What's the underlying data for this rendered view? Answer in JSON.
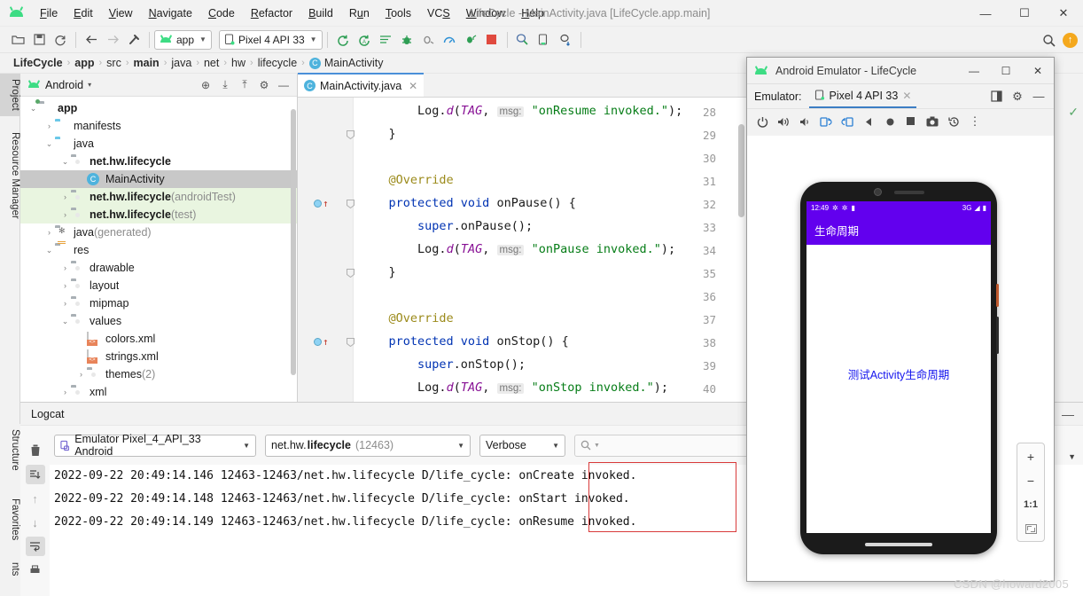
{
  "window": {
    "title": "LifeCycle - MainActivity.java [LifeCycle.app.main]",
    "minimize": "—",
    "maximize": "☐",
    "close": "✕"
  },
  "menu": {
    "items": [
      {
        "label": "File"
      },
      {
        "label": "Edit"
      },
      {
        "label": "View"
      },
      {
        "label": "Navigate"
      },
      {
        "label": "Code"
      },
      {
        "label": "Refactor"
      },
      {
        "label": "Build"
      },
      {
        "label": "Run"
      },
      {
        "label": "Tools"
      },
      {
        "label": "VCS"
      },
      {
        "label": "Window"
      },
      {
        "label": "Help"
      }
    ]
  },
  "toolbar": {
    "open_icon": "🗁",
    "save_icon": "💾",
    "sync_icon": "↻",
    "back_icon": "←",
    "forward_icon": "→",
    "build_icon": "🔨",
    "module_selector": "app",
    "device_selector": "Pixel 4 API 33",
    "run_icon": "▶",
    "run_label": "Run",
    "debug_label": "Debug",
    "search_icon": "🔍",
    "update_badge": "⬆"
  },
  "breadcrumb": {
    "items": [
      "LifeCycle",
      "app",
      "src",
      "main",
      "java",
      "net",
      "hw",
      "lifecycle"
    ],
    "class_badge": "C",
    "class_name": "MainActivity",
    "separator": "›"
  },
  "left_rail": {
    "project_tab": "Project",
    "resource_manager_tab": "Resource Manager"
  },
  "bottom_left_rail": {
    "structure_tab": "Structure",
    "favorites_tab": "Favorites",
    "partial_tab": "nts"
  },
  "project_panel": {
    "header_label": "Android",
    "header_caret": "▾",
    "icons": {
      "locate": "⊕",
      "expand": "⤓",
      "collapse": "⤒",
      "settings": "⚙",
      "hide": "—"
    },
    "tree": [
      {
        "label": "app",
        "indent": 0,
        "arrow": "⌄",
        "icon": "module",
        "bold": true
      },
      {
        "label": "manifests",
        "indent": 1,
        "arrow": "›",
        "icon": "folder-blue"
      },
      {
        "label": "java",
        "indent": 1,
        "arrow": "⌄",
        "icon": "folder-blue"
      },
      {
        "label": "net.hw.lifecycle",
        "indent": 2,
        "arrow": "⌄",
        "icon": "package",
        "bold": true
      },
      {
        "label": "MainActivity",
        "indent": 3,
        "arrow": "",
        "icon": "class",
        "selected": true
      },
      {
        "label": "net.hw.lifecycle",
        "suffix": " (androidTest)",
        "indent": 2,
        "arrow": "›",
        "icon": "package",
        "bold": true,
        "greenbg": true
      },
      {
        "label": "net.hw.lifecycle",
        "suffix": " (test)",
        "indent": 2,
        "arrow": "›",
        "icon": "package",
        "bold": true,
        "greenbg": true
      },
      {
        "label": "java",
        "suffix": " (generated)",
        "indent": 1,
        "arrow": "›",
        "icon": "generated"
      },
      {
        "label": "res",
        "indent": 1,
        "arrow": "⌄",
        "icon": "res"
      },
      {
        "label": "drawable",
        "indent": 2,
        "arrow": "›",
        "icon": "package"
      },
      {
        "label": "layout",
        "indent": 2,
        "arrow": "›",
        "icon": "package"
      },
      {
        "label": "mipmap",
        "indent": 2,
        "arrow": "›",
        "icon": "package"
      },
      {
        "label": "values",
        "indent": 2,
        "arrow": "⌄",
        "icon": "package"
      },
      {
        "label": "colors.xml",
        "indent": 3,
        "arrow": "",
        "icon": "xml"
      },
      {
        "label": "strings.xml",
        "indent": 3,
        "arrow": "",
        "icon": "xml"
      },
      {
        "label": "themes",
        "suffix": " (2)",
        "indent": 3,
        "arrow": "›",
        "icon": "package"
      },
      {
        "label": "xml",
        "indent": 2,
        "arrow": "›",
        "icon": "package"
      }
    ]
  },
  "editor": {
    "tab_badge": "C",
    "tab_label": "MainActivity.java",
    "tab_close": "✕",
    "lines": [
      {
        "num": "28",
        "segments": [
          {
            "t": "        ",
            "c": "plain"
          },
          {
            "t": "Log",
            "c": "plain"
          },
          {
            "t": ".",
            "c": "plain"
          },
          {
            "t": "d",
            "c": "fld"
          },
          {
            "t": "(",
            "c": "plain"
          },
          {
            "t": "TAG",
            "c": "fld"
          },
          {
            "t": ", ",
            "c": "plain"
          },
          {
            "t": "msg:",
            "c": "hint"
          },
          {
            "t": " ",
            "c": "plain"
          },
          {
            "t": "\"onResume invoked.\"",
            "c": "str"
          },
          {
            "t": ");",
            "c": "plain"
          }
        ]
      },
      {
        "num": "29",
        "fold": "⊖",
        "segments": [
          {
            "t": "    }",
            "c": "plain"
          }
        ]
      },
      {
        "num": "30",
        "segments": []
      },
      {
        "num": "31",
        "segments": [
          {
            "t": "    @Override",
            "c": "ann"
          }
        ]
      },
      {
        "num": "32",
        "mark": true,
        "fold": "⊖",
        "segments": [
          {
            "t": "    ",
            "c": "plain"
          },
          {
            "t": "protected void ",
            "c": "kw"
          },
          {
            "t": "onPause() {",
            "c": "plain"
          }
        ]
      },
      {
        "num": "33",
        "segments": [
          {
            "t": "        ",
            "c": "plain"
          },
          {
            "t": "super",
            "c": "kw"
          },
          {
            "t": ".onPause();",
            "c": "plain"
          }
        ]
      },
      {
        "num": "34",
        "segments": [
          {
            "t": "        ",
            "c": "plain"
          },
          {
            "t": "Log",
            "c": "plain"
          },
          {
            "t": ".",
            "c": "plain"
          },
          {
            "t": "d",
            "c": "fld"
          },
          {
            "t": "(",
            "c": "plain"
          },
          {
            "t": "TAG",
            "c": "fld"
          },
          {
            "t": ", ",
            "c": "plain"
          },
          {
            "t": "msg:",
            "c": "hint"
          },
          {
            "t": " ",
            "c": "plain"
          },
          {
            "t": "\"onPause invoked.\"",
            "c": "str"
          },
          {
            "t": ");",
            "c": "plain"
          }
        ]
      },
      {
        "num": "35",
        "fold": "⊖",
        "segments": [
          {
            "t": "    }",
            "c": "plain"
          }
        ]
      },
      {
        "num": "36",
        "segments": []
      },
      {
        "num": "37",
        "segments": [
          {
            "t": "    @Override",
            "c": "ann"
          }
        ]
      },
      {
        "num": "38",
        "mark": true,
        "fold": "⊖",
        "segments": [
          {
            "t": "    ",
            "c": "plain"
          },
          {
            "t": "protected void ",
            "c": "kw"
          },
          {
            "t": "onStop() {",
            "c": "plain"
          }
        ]
      },
      {
        "num": "39",
        "segments": [
          {
            "t": "        ",
            "c": "plain"
          },
          {
            "t": "super",
            "c": "kw"
          },
          {
            "t": ".onStop();",
            "c": "plain"
          }
        ]
      },
      {
        "num": "40",
        "segments": [
          {
            "t": "        ",
            "c": "plain"
          },
          {
            "t": "Log",
            "c": "plain"
          },
          {
            "t": ".",
            "c": "plain"
          },
          {
            "t": "d",
            "c": "fld"
          },
          {
            "t": "(",
            "c": "plain"
          },
          {
            "t": "TAG",
            "c": "fld"
          },
          {
            "t": ", ",
            "c": "plain"
          },
          {
            "t": "msg:",
            "c": "hint"
          },
          {
            "t": " ",
            "c": "plain"
          },
          {
            "t": "\"onStop invoked.\"",
            "c": "str"
          },
          {
            "t": ");",
            "c": "plain"
          }
        ]
      }
    ]
  },
  "logcat": {
    "title": "Logcat",
    "minimize": "—",
    "device_selector": "Emulator Pixel_4_API_33 Android",
    "process_prefix": "net.hw.",
    "process_bold": "lifecycle",
    "process_pid": " (12463)",
    "level_selector": "Verbose",
    "search_placeholder": "",
    "search_icon": "Q",
    "sidebar_icons": {
      "clear": "🗑",
      "scroll_end": "⤓",
      "up": "↑",
      "down": "↓",
      "wrap": "↩",
      "print": "🖨"
    },
    "lines": [
      {
        "prefix": "2022-09-22 20:49:14.146 12463-12463/net.hw.lifecycle D/life_cycle: ",
        "message": "onCreate invoked."
      },
      {
        "prefix": "2022-09-22 20:49:14.148 12463-12463/net.hw.lifecycle D/life_cycle: ",
        "message": "onStart invoked."
      },
      {
        "prefix": "2022-09-22 20:49:14.149 12463-12463/net.hw.lifecycle D/life_cycle: ",
        "message": "onResume invoked."
      }
    ],
    "highlight_color": "#d93a3a"
  },
  "emulator": {
    "title": "Android Emulator - LifeCycle",
    "minimize": "—",
    "maximize": "☐",
    "close": "✕",
    "tab_row_label": "Emulator:",
    "tab_label": "Pixel 4 API 33",
    "tab_close": "✕",
    "panel_icon": "◰",
    "settings_icon": "⚙",
    "hide_icon": "—",
    "controls": [
      {
        "name": "power",
        "glyph": "⏻"
      },
      {
        "name": "volume-up",
        "glyph": "🔊"
      },
      {
        "name": "volume-down",
        "glyph": "🔉"
      },
      {
        "name": "rotate-left",
        "glyph": "↺"
      },
      {
        "name": "rotate-right",
        "glyph": "↻"
      },
      {
        "name": "back",
        "glyph": "◀"
      },
      {
        "name": "home",
        "glyph": "●"
      },
      {
        "name": "overview",
        "glyph": "■"
      },
      {
        "name": "screenshot",
        "glyph": "📷"
      },
      {
        "name": "history",
        "glyph": "↺"
      },
      {
        "name": "more",
        "glyph": "⋮"
      }
    ],
    "zoom_controls": {
      "zoom_in": "+",
      "zoom_out": "−",
      "actual_size": "1:1",
      "fit_screen": "fit"
    }
  },
  "phone": {
    "status_time": "12:49",
    "status_icons_left": [
      "⚙",
      "⚙",
      "▮"
    ],
    "status_network": "3G",
    "status_signal": "◢",
    "status_battery": "▮",
    "app_title": "生命周期",
    "center_text": "测试Activity生命周期",
    "accent_color": "#6200ee",
    "text_color": "#1515ee"
  },
  "watermark": "CSDN @howard2005"
}
